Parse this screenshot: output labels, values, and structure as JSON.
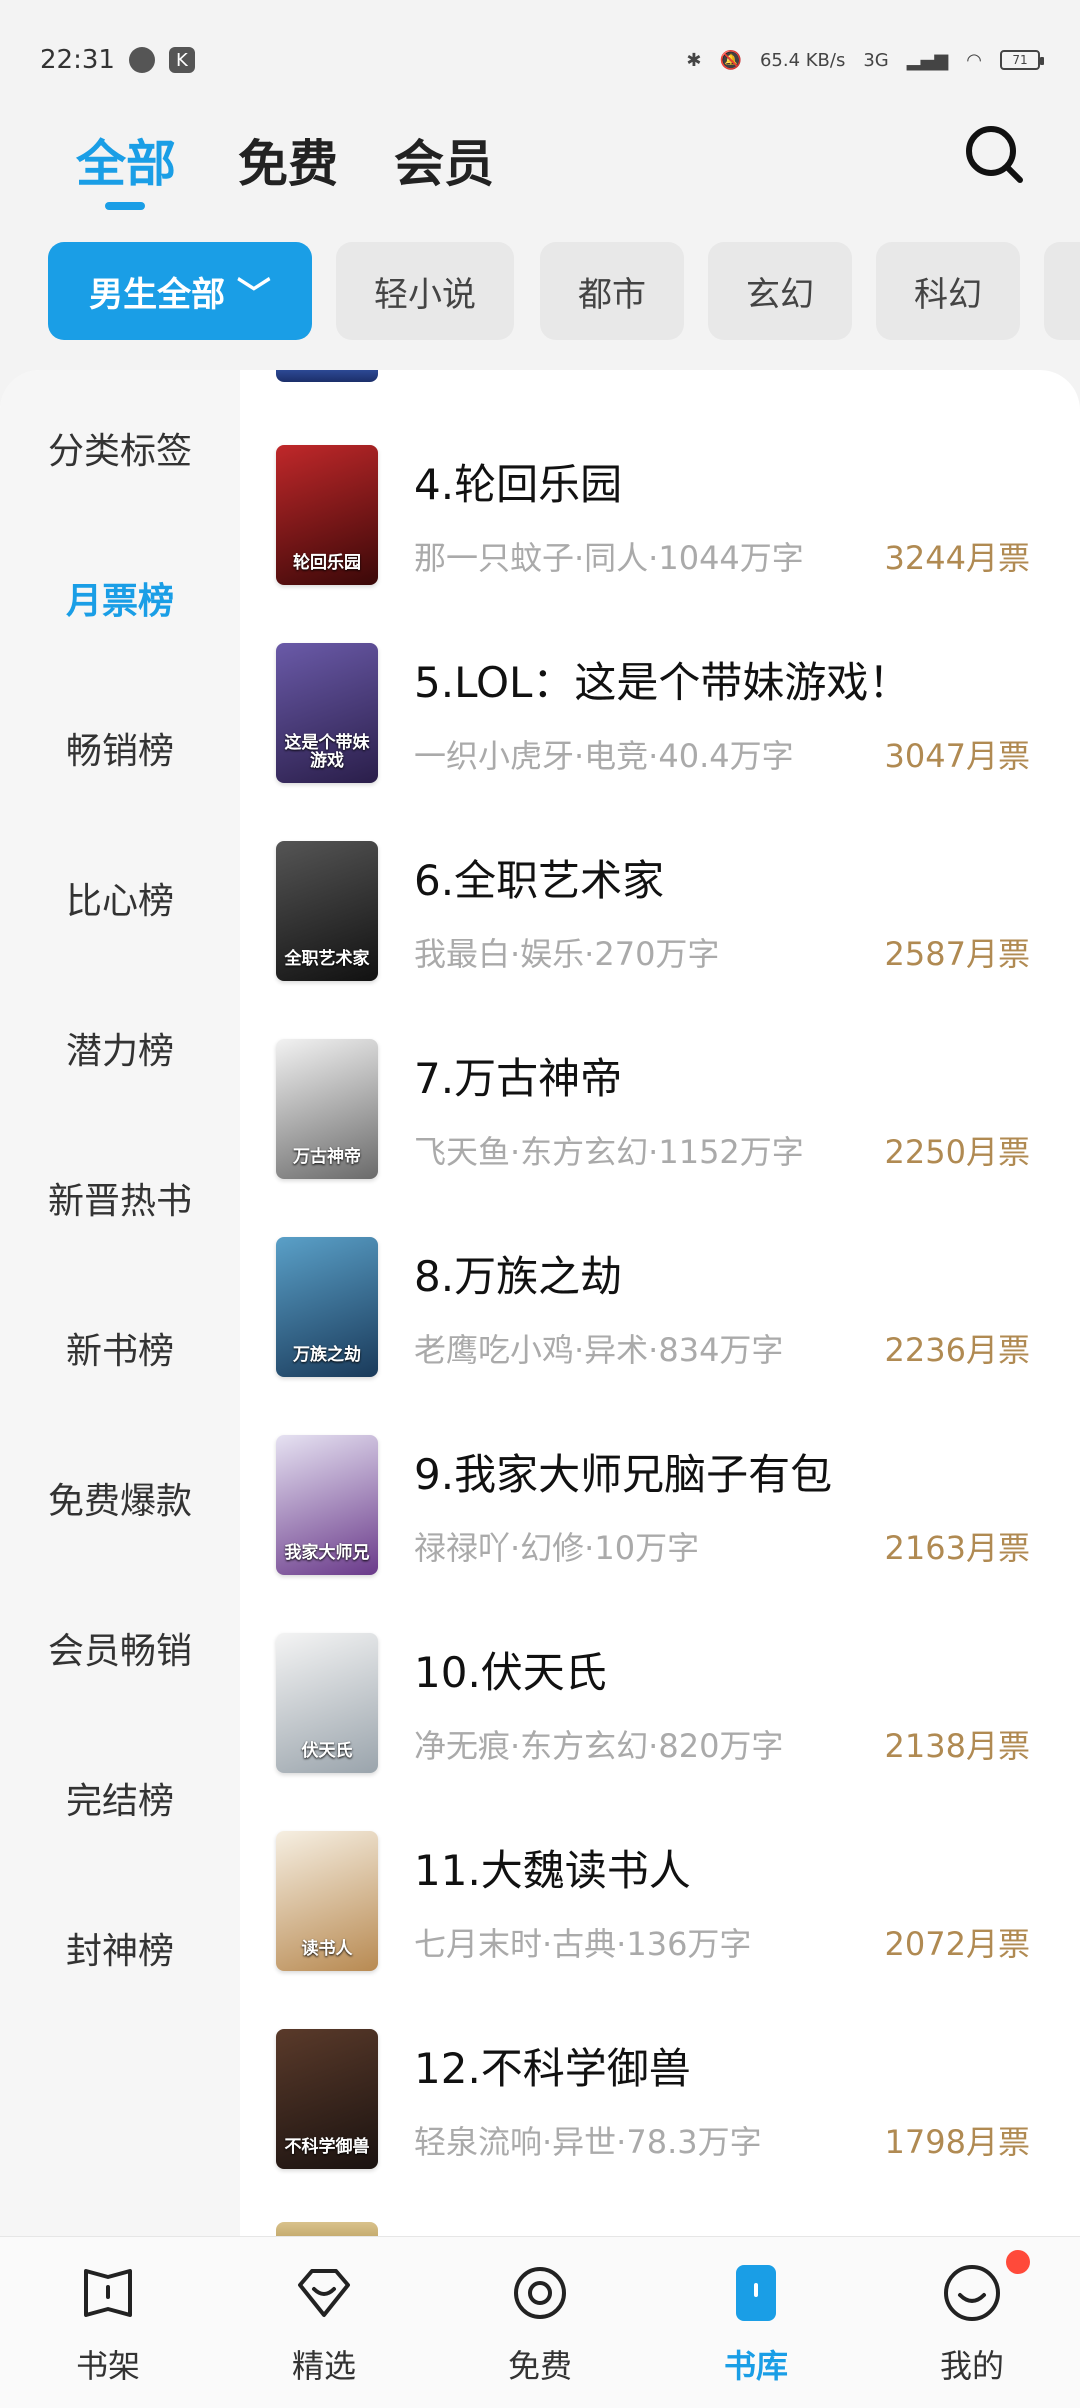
{
  "status_bar": {
    "time": "22:31",
    "battery": "71",
    "network": "3G",
    "speed": "65.4 KB/s"
  },
  "top_tabs": [
    {
      "label": "全部",
      "active": true
    },
    {
      "label": "免费",
      "active": false
    },
    {
      "label": "会员",
      "active": false
    }
  ],
  "filters": [
    {
      "label": "男生全部 ﹀",
      "active": true
    },
    {
      "label": "轻小说",
      "active": false
    },
    {
      "label": "都市",
      "active": false
    },
    {
      "label": "玄幻",
      "active": false
    },
    {
      "label": "科幻",
      "active": false
    }
  ],
  "sidebar": [
    {
      "label": "分类标签",
      "active": false
    },
    {
      "label": "月票榜",
      "active": true
    },
    {
      "label": "畅销榜",
      "active": false
    },
    {
      "label": "比心榜",
      "active": false
    },
    {
      "label": "潜力榜",
      "active": false
    },
    {
      "label": "新晋热书",
      "active": false
    },
    {
      "label": "新书榜",
      "active": false
    },
    {
      "label": "免费爆款",
      "active": false
    },
    {
      "label": "会员畅销",
      "active": false
    },
    {
      "label": "完结榜",
      "active": false
    },
    {
      "label": "封神榜",
      "active": false
    }
  ],
  "books": [
    {
      "title": "4.轮回乐园",
      "meta": "那一只蚊子·同人·1044万字",
      "votes": "3244月票",
      "cover_text": "轮回乐园",
      "cover_colors": [
        "#c0282a",
        "#3a0808"
      ]
    },
    {
      "title": "5.LOL：这是个带妹游戏！",
      "meta": "一织小虎牙·电竞·40.4万字",
      "votes": "3047月票",
      "cover_text": "这是个带妹游戏",
      "cover_colors": [
        "#6a5aa8",
        "#2a1e4a"
      ]
    },
    {
      "title": "6.全职艺术家",
      "meta": "我最白·娱乐·270万字",
      "votes": "2587月票",
      "cover_text": "全职艺术家",
      "cover_colors": [
        "#555555",
        "#111111"
      ]
    },
    {
      "title": "7.万古神帝",
      "meta": "飞天鱼·东方玄幻·1152万字",
      "votes": "2250月票",
      "cover_text": "万古神帝",
      "cover_colors": [
        "#f2f2f2",
        "#6a6a6a"
      ]
    },
    {
      "title": "8.万族之劫",
      "meta": "老鹰吃小鸡·异术·834万字",
      "votes": "2236月票",
      "cover_text": "万族之劫",
      "cover_colors": [
        "#5aa0c8",
        "#1a3a5a"
      ]
    },
    {
      "title": "9.我家大师兄脑子有包",
      "meta": "禄禄吖·幻修·10万字",
      "votes": "2163月票",
      "cover_text": "我家大师兄",
      "cover_colors": [
        "#e6e2f2",
        "#6a3a8a"
      ]
    },
    {
      "title": "10.伏天氏",
      "meta": "净无痕·东方玄幻·820万字",
      "votes": "2138月票",
      "cover_text": "伏天氏",
      "cover_colors": [
        "#f4f4f4",
        "#9aa4ac"
      ]
    },
    {
      "title": "11.大魏读书人",
      "meta": "七月末时·古典·136万字",
      "votes": "2072月票",
      "cover_text": "读书人",
      "cover_colors": [
        "#f6efe2",
        "#b88a52"
      ]
    },
    {
      "title": "12.不科学御兽",
      "meta": "轻泉流响·异世·78.3万字",
      "votes": "1798月票",
      "cover_text": "不科学御兽",
      "cover_colors": [
        "#5a3a2a",
        "#1a1210"
      ]
    }
  ],
  "bottom_nav": [
    {
      "label": "书架",
      "icon": "bookshelf-icon",
      "active": false
    },
    {
      "label": "精选",
      "icon": "heart-icon",
      "active": false
    },
    {
      "label": "免费",
      "icon": "target-icon",
      "active": false
    },
    {
      "label": "书库",
      "icon": "library-icon",
      "active": true
    },
    {
      "label": "我的",
      "icon": "smile-icon",
      "active": false
    }
  ],
  "accent_color": "#1a9ee6"
}
